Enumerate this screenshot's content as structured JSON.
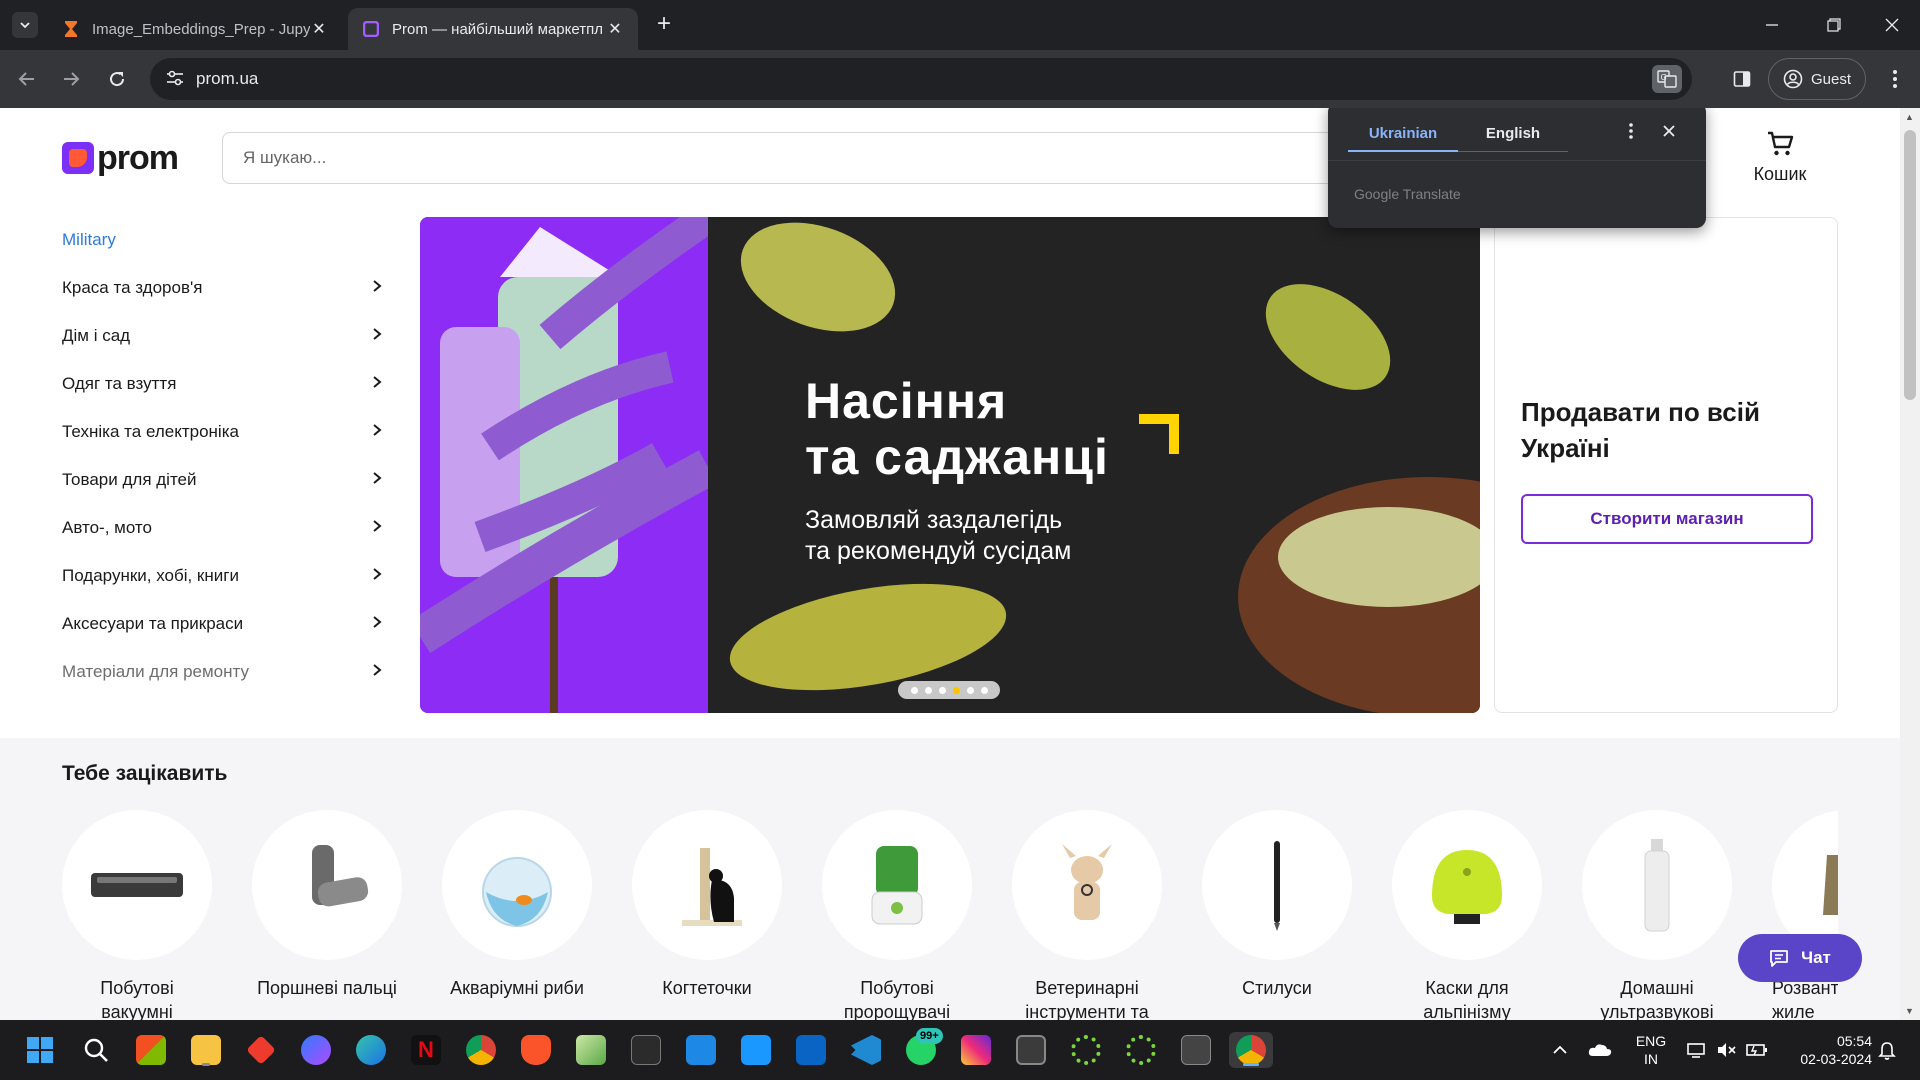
{
  "browser": {
    "tabs": [
      {
        "title": "Image_Embeddings_Prep - Jupy",
        "icon": "hourglass-icon",
        "active": false
      },
      {
        "title": "Prom — найбільший маркетпл",
        "icon": "prom-favicon",
        "active": true
      }
    ],
    "url": "prom.ua",
    "profile_label": "Guest"
  },
  "translate_popup": {
    "languages": [
      "Ukrainian",
      "English"
    ],
    "selected": "Ukrainian",
    "brand": "Google Translate"
  },
  "header": {
    "logo_text": "prom",
    "search_placeholder": "Я шукаю...",
    "cart_label": "Кошик"
  },
  "categories": [
    {
      "label": "Military",
      "chevron": false
    },
    {
      "label": "Краса та здоров'я",
      "chevron": true
    },
    {
      "label": "Дім і сад",
      "chevron": true
    },
    {
      "label": "Одяг та взуття",
      "chevron": true
    },
    {
      "label": "Техніка та електроніка",
      "chevron": true
    },
    {
      "label": "Товари для дітей",
      "chevron": true
    },
    {
      "label": "Авто-, мото",
      "chevron": true
    },
    {
      "label": "Подарунки, хобі, книги",
      "chevron": true
    },
    {
      "label": "Аксесуари та прикраси",
      "chevron": true
    },
    {
      "label": "Матеріали для ремонту",
      "chevron": true
    }
  ],
  "banner": {
    "title_line1": "Насіння",
    "title_line2": "та саджанці",
    "subtitle_line1": "Замовляй заздалегідь",
    "subtitle_line2": "та рекомендуй сусідам",
    "slides": 6,
    "active_slide": 4,
    "accent": "#ffd400"
  },
  "sell_card": {
    "title": "Продавати по всій Україні",
    "button": "Створити магазин"
  },
  "suggestions": {
    "title": "Тебе зацікавить",
    "items": [
      {
        "label": "Побутові вакуумні пакувальники",
        "icon": "vacuum-sealer-icon"
      },
      {
        "label": "Поршневі пальці",
        "icon": "piston-pin-icon"
      },
      {
        "label": "Акваріумні риби",
        "icon": "fishbowl-icon"
      },
      {
        "label": "Когтеточки",
        "icon": "cat-scratcher-icon"
      },
      {
        "label": "Побутові пророщувачі",
        "icon": "sprouter-icon"
      },
      {
        "label": "Ветеринарні інструменти та",
        "icon": "vet-dog-icon"
      },
      {
        "label": "Стилуси",
        "icon": "stylus-icon"
      },
      {
        "label": "Каски для альпінізму",
        "icon": "helmet-icon"
      },
      {
        "label": "Домашні ультразвукові",
        "icon": "bottle-icon"
      },
      {
        "label": "Розвант жиле",
        "icon": "vest-icon"
      }
    ]
  },
  "chat_label": "Чат",
  "taskbar": {
    "notification_badge": "99+",
    "language": [
      "ENG",
      "IN"
    ],
    "time": "05:54",
    "date": "02-03-2024"
  },
  "colors": {
    "prom_purple": "#7b2ff7",
    "link_blue": "#2e7bd8",
    "chat_button": "#5a44c8",
    "chrome_dark": "#202124"
  }
}
